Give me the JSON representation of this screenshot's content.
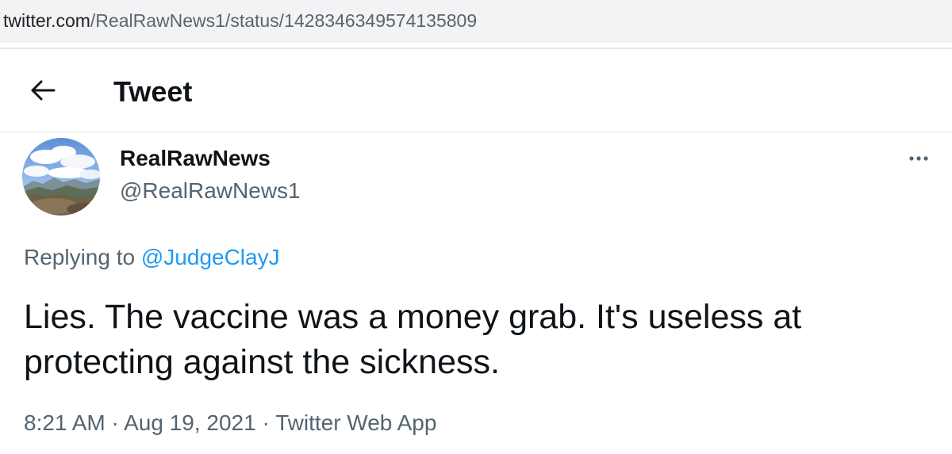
{
  "browser": {
    "url_domain": "twitter.com",
    "url_path": "/RealRawNews1/status/1428346349574135809"
  },
  "header": {
    "back_icon": "arrow-left-icon",
    "title": "Tweet"
  },
  "tweet": {
    "avatar_icon": "landscape-avatar",
    "display_name": "RealRawNews",
    "handle": "@RealRawNews1",
    "more_icon": "ellipsis-icon",
    "replying_to_prefix": "Replying to ",
    "replying_to_handle": "@JudgeClayJ",
    "text_line_1": "Lies. The vaccine was a money grab. It's useless at",
    "text_line_2": "protecting against the sickness.",
    "time": "8:21 AM",
    "separator": " · ",
    "date": "Aug 19, 2021",
    "source": "Twitter Web App"
  },
  "colors": {
    "link_blue": "#1d9bf0",
    "text_primary": "#0f1419",
    "text_secondary": "#536471",
    "url_bar_bg": "#f1f3f4"
  }
}
